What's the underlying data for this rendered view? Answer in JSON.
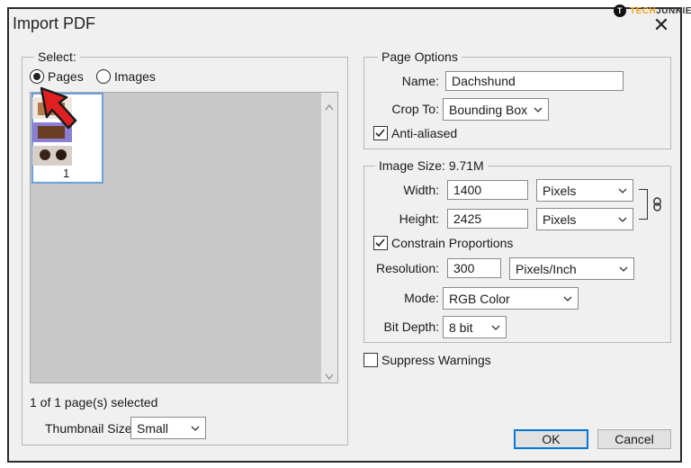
{
  "dialog": {
    "title": "Import PDF",
    "close_glyph": "✕"
  },
  "watermark": {
    "letter": "T",
    "brand_a": "TECH",
    "brand_b": "JUNKIE"
  },
  "select": {
    "legend": "Select:",
    "pages_label": "Pages",
    "images_label": "Images",
    "selected_option": "Pages",
    "thumbnail_page_number": "1",
    "status": "1 of 1 page(s) selected",
    "thumbnail_size_label": "Thumbnail Size:",
    "thumbnail_size_value": "Small"
  },
  "page_options": {
    "legend": "Page Options",
    "name_label": "Name:",
    "name_value": "Dachshund",
    "crop_label": "Crop To:",
    "crop_value": "Bounding Box",
    "anti_aliased_label": "Anti-aliased",
    "anti_aliased_checked": true
  },
  "image_size": {
    "legend": "Image Size: 9.71M",
    "width_label": "Width:",
    "width_value": "1400",
    "width_unit": "Pixels",
    "height_label": "Height:",
    "height_value": "2425",
    "height_unit": "Pixels",
    "constrain_label": "Constrain Proportions",
    "constrain_checked": true,
    "resolution_label": "Resolution:",
    "resolution_value": "300",
    "resolution_unit": "Pixels/Inch",
    "mode_label": "Mode:",
    "mode_value": "RGB Color",
    "bit_depth_label": "Bit Depth:",
    "bit_depth_value": "8 bit"
  },
  "suppress_warnings": {
    "label": "Suppress Warnings",
    "checked": false
  },
  "buttons": {
    "ok": "OK",
    "cancel": "Cancel"
  },
  "colors": {
    "accent": "#0078d7",
    "annotation_arrow": "#e02020",
    "thumbnail_bg": "#c8c8c8",
    "image_band": "#8a7fd0"
  },
  "icons": {
    "arrow": "red-arrow-icon",
    "link": "chain-link-icon",
    "chevron": "chevron-down-icon"
  }
}
